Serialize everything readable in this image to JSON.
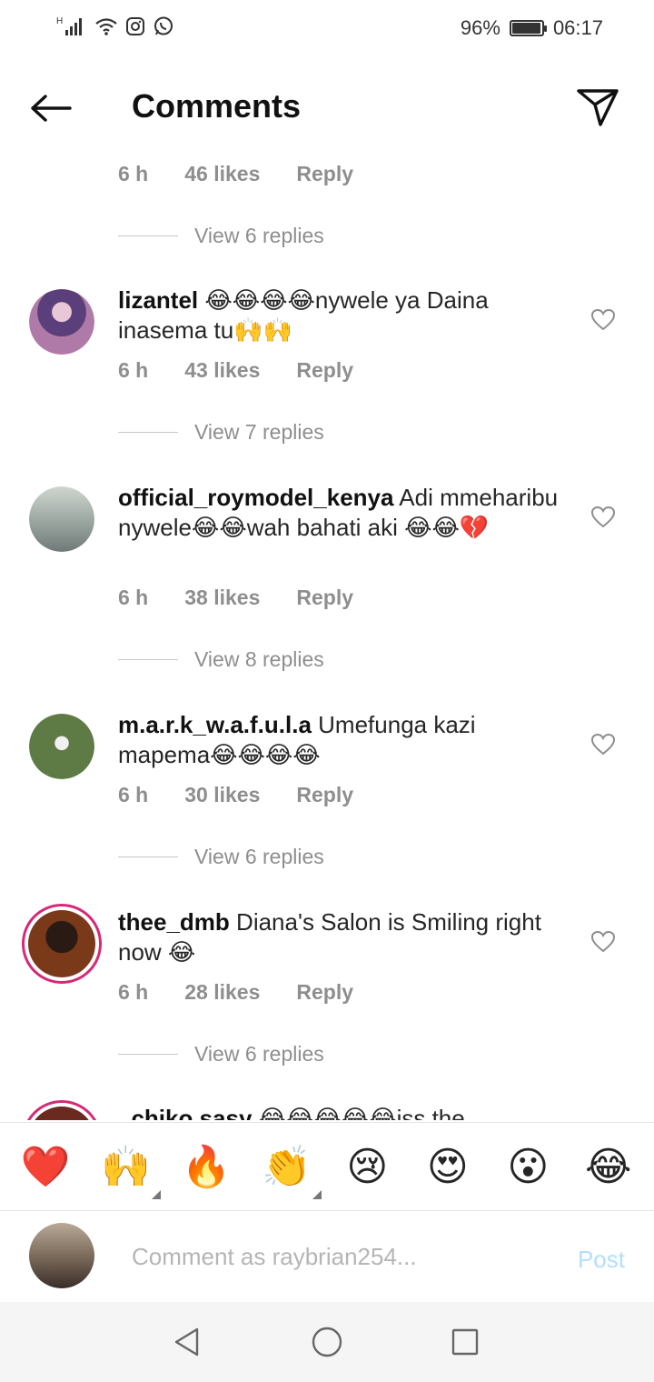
{
  "status_bar": {
    "network": "H",
    "battery": "96%",
    "battery_level": 0.96,
    "time": "06:17"
  },
  "header": {
    "title": "Comments",
    "back_icon": "arrow-left-icon",
    "send_icon": "paper-plane-icon"
  },
  "comments": [
    {
      "username": "",
      "text": "",
      "time": "6 h",
      "likes": "46 likes",
      "reply": "Reply",
      "view_replies": "View 6 replies",
      "partial": true
    },
    {
      "username": "lizantel",
      "text": "😂😂😂😂nywele ya Daina inasema tu🙌🙌",
      "time": "6 h",
      "likes": "43 likes",
      "reply": "Reply",
      "view_replies": "View 7 replies"
    },
    {
      "username": "official_roymodel_kenya",
      "text": "Adi mmeharibu nywele😂😂wah bahati aki 😂😂💔",
      "time": "6 h",
      "likes": "38 likes",
      "reply": "Reply",
      "view_replies": "View 8 replies"
    },
    {
      "username": "m.a.r.k_w.a.f.u.l.a",
      "text": "Umefunga kazi mapema😂😂😂😂",
      "time": "6 h",
      "likes": "30 likes",
      "reply": "Reply",
      "view_replies": "View 6 replies"
    },
    {
      "username": "thee_dmb",
      "text": "Diana's Salon is Smiling right now 😂",
      "time": "6 h",
      "likes": "28 likes",
      "reply": "Reply",
      "view_replies": "View 6 replies"
    },
    {
      "username": "_chiko.sasy",
      "text": "😂😂😂😂😂iss the"
    }
  ],
  "reactions": [
    {
      "emoji": "❤️",
      "name": "red-heart"
    },
    {
      "emoji": "🙌",
      "name": "raising-hands"
    },
    {
      "emoji": "🔥",
      "name": "fire"
    },
    {
      "emoji": "👏",
      "name": "clapping-hands"
    },
    {
      "emoji": "😢",
      "name": "crying-face"
    },
    {
      "emoji": "😍",
      "name": "heart-eyes"
    },
    {
      "emoji": "😮",
      "name": "surprised-face"
    },
    {
      "emoji": "😂",
      "name": "tears-of-joy"
    }
  ],
  "compose": {
    "placeholder": "Comment as raybrian254...",
    "post_label": "Post"
  },
  "colors": {
    "story_ring": "#e1306c",
    "meta_gray": "#8e8e8e",
    "post_blue": "#b2dffc"
  }
}
